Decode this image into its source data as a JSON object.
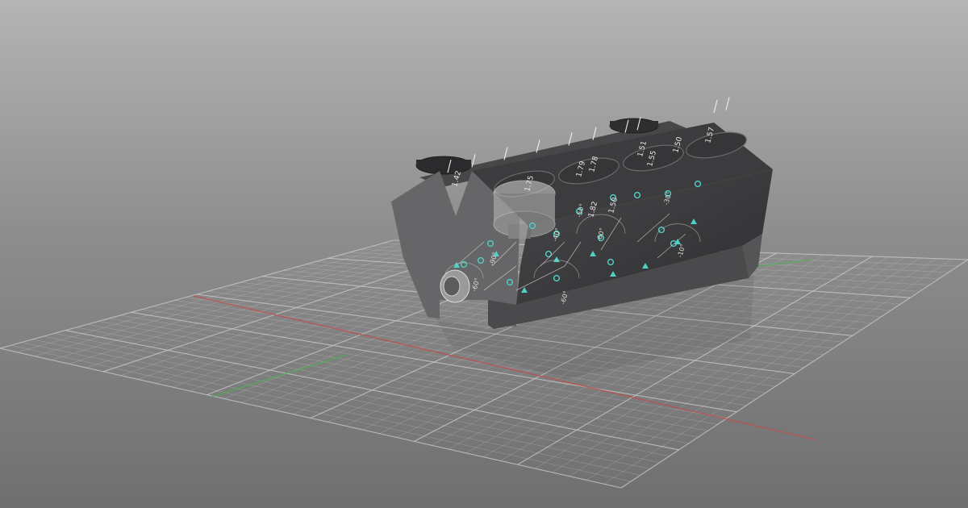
{
  "viewport": {
    "background_top": "#b4b4b4",
    "background_bottom": "#6f6f6f",
    "grid_line_color": "#c9c9c9",
    "axis_x_color": "#c0504d",
    "axis_y_color": "#4caf50",
    "model_body_color": "#3a3a3c",
    "model_side_color": "#5c5c5e",
    "constraint_color": "#4fd1c5"
  },
  "dimension_labels": [
    "1.42",
    "1.75",
    "1.79",
    "1.78",
    "1.51",
    "1.55",
    "1.57",
    "1.50",
    "1.50",
    "1.82"
  ],
  "angle_labels": [
    "-60°",
    "-90°",
    "-60°",
    "-60°",
    "-30°",
    "-10°",
    "-50°",
    "-40°"
  ]
}
